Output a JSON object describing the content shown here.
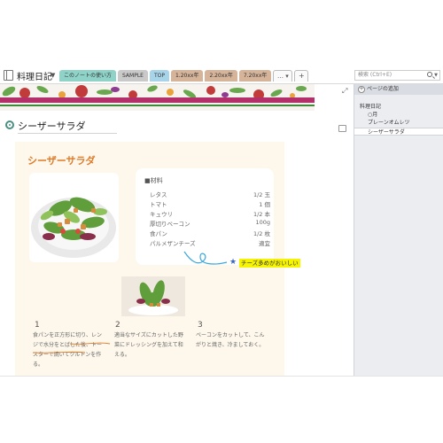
{
  "notebook": {
    "title": "料理日記"
  },
  "tabs": [
    {
      "label": "このノートの使い方",
      "color": "#8fd3c8"
    },
    {
      "label": "SAMPLE",
      "color": "#c9c9c9"
    },
    {
      "label": "TOP",
      "color": "#a8d4ea"
    },
    {
      "label": "1.20xx年",
      "color": "#d6b49a"
    },
    {
      "label": "2.20xx年",
      "color": "#d6b49a"
    },
    {
      "label": "7.20xx年",
      "color": "#d6b49a"
    }
  ],
  "search": {
    "placeholder": "検索 (Ctrl+E)"
  },
  "side_panel": {
    "add_page_label": "ページの追加",
    "items": [
      {
        "label": "料理日記"
      },
      {
        "label": "○月"
      },
      {
        "label": "プレーンオムレツ"
      },
      {
        "label": "シーザーサラダ"
      }
    ]
  },
  "page": {
    "title": "シーザーサラダ"
  },
  "recipe": {
    "title": "シーザーサラダ",
    "ingredients_heading": "■材料",
    "ingredients": [
      {
        "name": "レタス",
        "amount": "1/2 玉"
      },
      {
        "name": "トマト",
        "amount": "1 個"
      },
      {
        "name": "キュウリ",
        "amount": "1/2 本"
      },
      {
        "name": "厚切りベーコン",
        "amount": "100g"
      },
      {
        "name": "食パン",
        "amount": "1/2 枚"
      },
      {
        "name": "パルメザンチーズ",
        "amount": "適宜"
      }
    ],
    "note": "チーズ多めがおいしい",
    "steps": [
      {
        "num": "1",
        "text": "食パンを正方形に切り、レンジで水分をとばした後、トースターで焼いてクルトンを作る。"
      },
      {
        "num": "2",
        "text": "適当なサイズにカットした野菜にドレッシングを加えて和える。"
      },
      {
        "num": "3",
        "text": "ベーコンをカットして、こんがりと焼き、冷ましておく。"
      }
    ]
  },
  "colors": {
    "accent_orange": "#e07b28",
    "title_circle": "#4a8f82",
    "highlight": "#f6f400",
    "banner_stripe": "#b3306a"
  }
}
